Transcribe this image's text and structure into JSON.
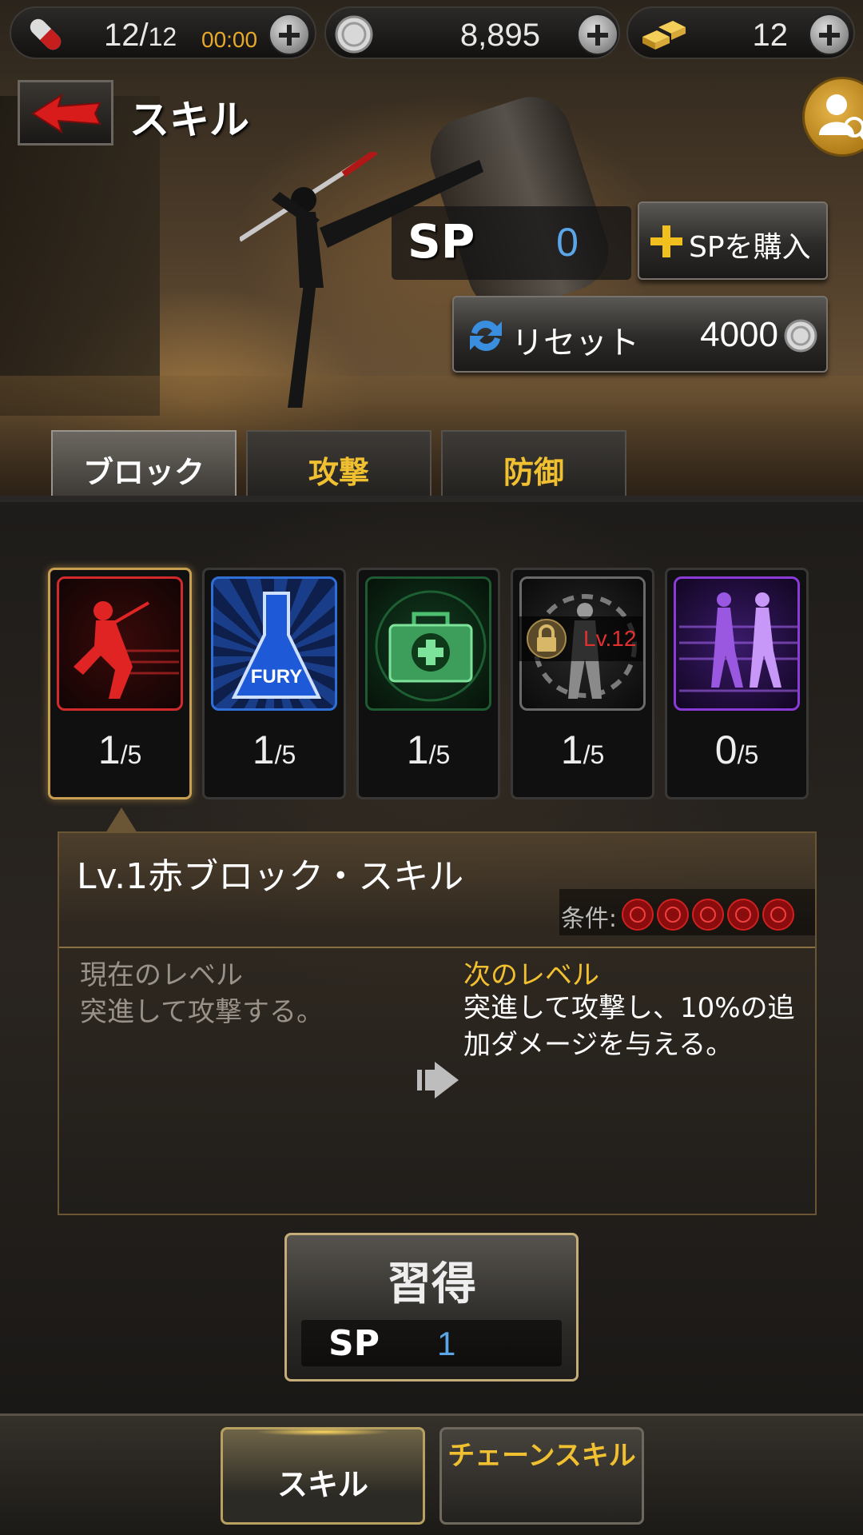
{
  "resources": {
    "stamina": {
      "value": "12/",
      "max": "12",
      "timer": "00:00"
    },
    "silver": {
      "value": "8,895"
    },
    "gold": {
      "value": "12"
    }
  },
  "header": {
    "title": "スキル"
  },
  "sp": {
    "label": "SP",
    "value": "0",
    "buy_label": "SPを購入"
  },
  "reset": {
    "label": "リセット",
    "cost": "4000"
  },
  "tabs": [
    {
      "label": "ブロック",
      "active": true
    },
    {
      "label": "攻撃",
      "active": false
    },
    {
      "label": "防御",
      "active": false
    }
  ],
  "skills": [
    {
      "icon": "red-block-fighter-icon",
      "level": "1",
      "max": "/5",
      "color": "#d22a2a",
      "selected": true
    },
    {
      "icon": "fury-flask-icon",
      "level": "1",
      "max": "/5",
      "color": "#2f6fd6"
    },
    {
      "icon": "medkit-icon",
      "level": "1",
      "max": "/5",
      "color": "#2f9a52"
    },
    {
      "icon": "locked-fighter-icon",
      "level": "1",
      "max": "/5",
      "color": "#8a8a8a",
      "lock_level": "Lv.12"
    },
    {
      "icon": "walking-fighters-icon",
      "level": "0",
      "max": "/5",
      "color": "#8a3ad6"
    }
  ],
  "detail": {
    "name": "Lv.1赤ブロック・スキル",
    "condition_label": "条件:",
    "current_heading": "現在のレベル",
    "current_text": "突進して攻撃する。",
    "next_heading": "次のレベル",
    "next_text": "突進して攻撃し、10%の追加ダメージを与える。"
  },
  "learn": {
    "label": "習得",
    "sp_label": "SP",
    "sp_cost": "1"
  },
  "bottom_nav": {
    "skill": "スキル",
    "chain": "チェーンスキル"
  }
}
